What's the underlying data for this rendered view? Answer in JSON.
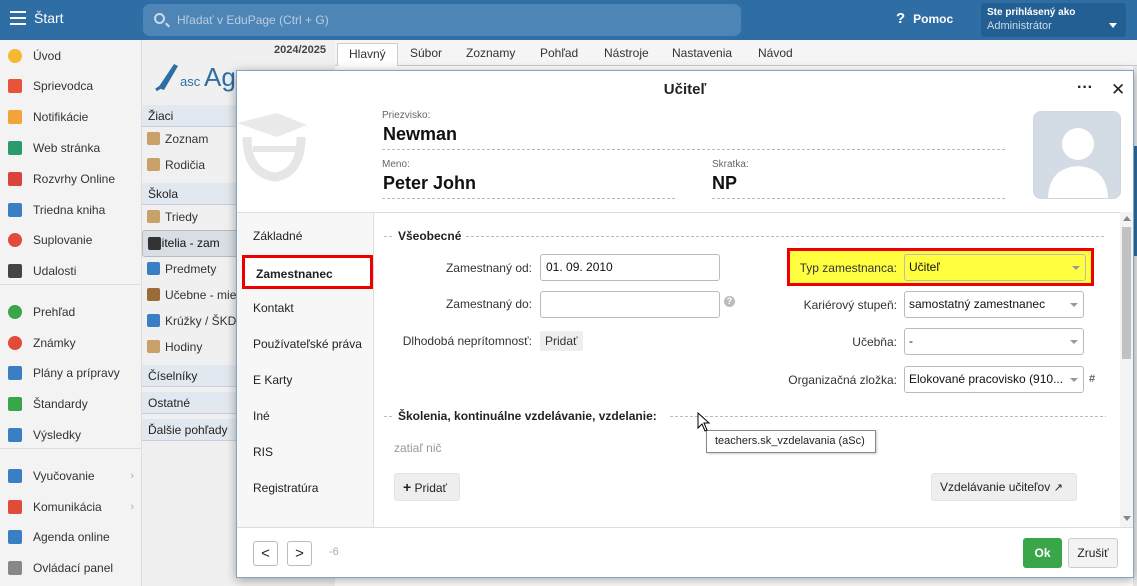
{
  "topbar": {
    "start_label": "Štart",
    "search_placeholder": "Hľadať v EduPage (Ctrl + G)",
    "help_label": "Pomoc",
    "user_line1": "Ste prihlásený ako",
    "user_line2": "Administrátor"
  },
  "sidebar": {
    "items": [
      {
        "label": "Úvod",
        "icon": "star-icon",
        "color": "#f5b82e"
      },
      {
        "label": "Sprievodca",
        "icon": "wand-icon",
        "color": "#e8543a"
      },
      {
        "label": "Notifikácie",
        "icon": "envelope-icon",
        "color": "#f2a33a"
      },
      {
        "label": "Web stránka",
        "icon": "house-icon",
        "color": "#2c9b6c"
      },
      {
        "label": "Rozvrhy Online",
        "icon": "grid-icon",
        "color": "#d9453b"
      },
      {
        "label": "Triedna kniha",
        "icon": "book-icon",
        "color": "#3a7fc4"
      },
      {
        "label": "Suplovanie",
        "icon": "person-icon",
        "color": "#e04b3a"
      },
      {
        "label": "Udalosti",
        "icon": "calendar-icon",
        "color": "#444444"
      },
      {
        "label": "Prehľad",
        "icon": "check-circle-icon",
        "color": "#3aa64a"
      },
      {
        "label": "Známky",
        "icon": "medal-icon",
        "color": "#e04b3a"
      },
      {
        "label": "Plány a prípravy",
        "icon": "briefcase-icon",
        "color": "#3a7fc4"
      },
      {
        "label": "Štandardy",
        "icon": "shield-check-icon",
        "color": "#3aa64a"
      },
      {
        "label": "Výsledky",
        "icon": "bar-chart-icon",
        "color": "#3a7fc4"
      },
      {
        "label": "Vyučovanie",
        "icon": "layers-icon",
        "color": "#3a7fc4"
      },
      {
        "label": "Komunikácia",
        "icon": "chat-icon",
        "color": "#e04b3a"
      },
      {
        "label": "Agenda online",
        "icon": "pen-icon",
        "color": "#3a7fc4"
      },
      {
        "label": "Ovládací panel",
        "icon": "gear-icon",
        "color": "#888888"
      }
    ]
  },
  "midcol": {
    "year": "2024/2025",
    "sections": [
      {
        "header": "Žiaci",
        "items": [
          "Zoznam",
          "Rodičia"
        ]
      },
      {
        "header": "Škola",
        "items": [
          "Triedy",
          "Učitelia - zam",
          "Predmety",
          "Učebne - mie",
          "Krúžky / ŠKD",
          "Hodiny"
        ]
      },
      {
        "header": "Číselníky",
        "items": []
      },
      {
        "header": "Ostatné",
        "items": []
      },
      {
        "header": "Ďalšie pohľady",
        "items": []
      }
    ]
  },
  "tabs": [
    "Hlavný",
    "Súbor",
    "Zoznamy",
    "Pohľad",
    "Nástroje",
    "Nastavenia",
    "Návod"
  ],
  "dialog": {
    "title": "Učiteľ",
    "more": "···",
    "close": "✕",
    "surname_label": "Priezvisko:",
    "surname": "Newman",
    "name_label": "Meno:",
    "name": "Peter John",
    "abbr_label": "Skratka:",
    "abbr": "NP",
    "nav": [
      "Základné",
      "Zamestnanec",
      "Kontakt",
      "Používateľské práva",
      "E Karty",
      "Iné",
      "RIS",
      "Registratúra"
    ],
    "active_nav": "Zamestnanec",
    "general_section": "Všeobecné",
    "employed_from_label": "Zamestnaný od:",
    "employed_from": "01. 09. 2010",
    "employed_to_label": "Zamestnaný do:",
    "employed_to": "",
    "absence_label": "Dlhodobá neprítomnosť:",
    "absence_add": "Pridať",
    "emp_type_label": "Typ zamestnanca:",
    "emp_type": "Učiteľ",
    "career_label": "Kariérový stupeň:",
    "career": "samostatný zamestnanec",
    "room_label": "Učebňa:",
    "room": "-",
    "org_label": "Organizačná zložka:",
    "org": "Elokované pracovisko (910...",
    "org_hash": "#",
    "training_section": "Školenia, kontinuálne vzdelávanie, vzdelanie:",
    "training_empty": "zatiaľ nič",
    "add_button": "Pridať",
    "education_button": "Vzdelávanie učiteľov",
    "tooltip": "teachers.sk_vzdelavania (aSc)",
    "prev": "<",
    "next": ">",
    "counter": "-6",
    "ok": "Ok",
    "cancel": "Zrušiť"
  },
  "colors": {
    "topbar": "#2f6ea5",
    "highlight_border": "#e00000",
    "highlight_fill": "#ffff40",
    "ok_button": "#3aa64a"
  }
}
